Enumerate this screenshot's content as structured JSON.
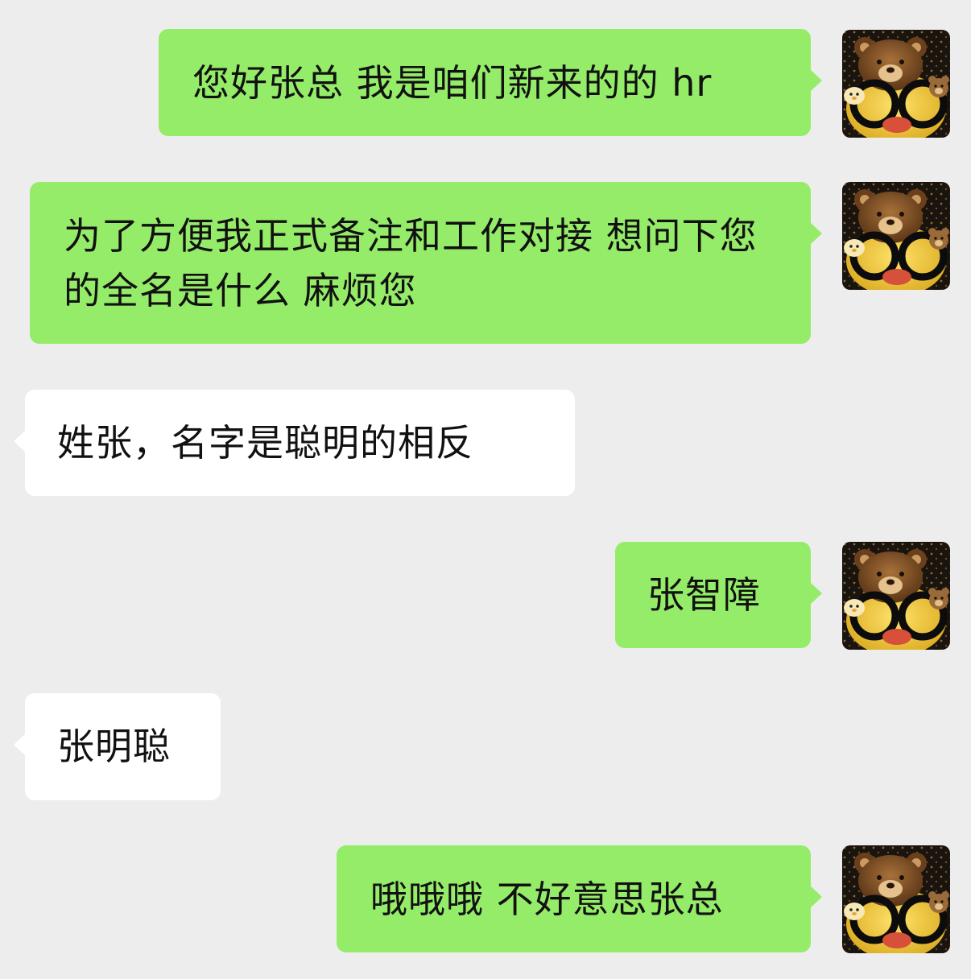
{
  "chat": {
    "messages": [
      {
        "sender": "self",
        "text": "您好张总 我是咱们新来的的 hr"
      },
      {
        "sender": "self",
        "text": "为了方便我正式备注和工作对接 想问下您的全名是什么 麻烦您"
      },
      {
        "sender": "other",
        "text": "姓张，名字是聪明的相反"
      },
      {
        "sender": "self",
        "text": "张智障"
      },
      {
        "sender": "other",
        "text": "张明聪"
      },
      {
        "sender": "self",
        "text": "哦哦哦 不好意思张总"
      }
    ],
    "self_avatar_icon": "brown-bear-with-glasses-avatar",
    "colors": {
      "background": "#ededed",
      "self_bubble": "#95ec69",
      "other_bubble": "#ffffff",
      "text": "#111111"
    }
  }
}
